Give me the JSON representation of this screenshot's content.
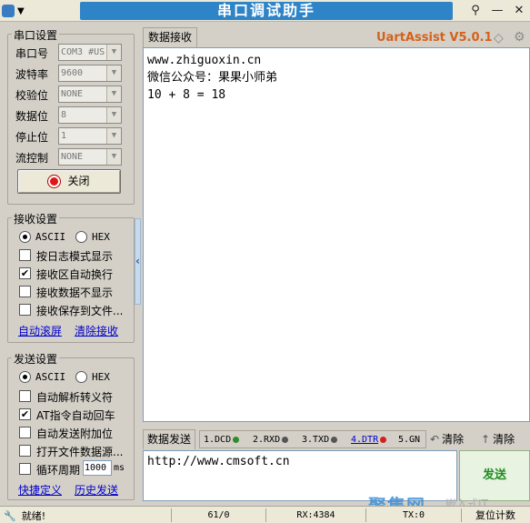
{
  "window": {
    "title": "串口调试助手",
    "brand": "UartAssist V5.0.1"
  },
  "serial": {
    "group_title": "串口设置",
    "port_label": "串口号",
    "port_value": "COM3 #US",
    "baud_label": "波特率",
    "baud_value": "9600",
    "parity_label": "校验位",
    "parity_value": "NONE",
    "databits_label": "数据位",
    "databits_value": "8",
    "stopbits_label": "停止位",
    "stopbits_value": "1",
    "flow_label": "流控制",
    "flow_value": "NONE",
    "close_label": "关闭"
  },
  "receive_settings": {
    "group_title": "接收设置",
    "ascii_label": "ASCII",
    "hex_label": "HEX",
    "options": [
      {
        "label": "按日志模式显示",
        "checked": false
      },
      {
        "label": "接收区自动换行",
        "checked": true
      },
      {
        "label": "接收数据不显示",
        "checked": false
      },
      {
        "label": "接收保存到文件...",
        "checked": false
      }
    ],
    "link_autoscroll": "自动滚屏",
    "link_clear": "清除接收"
  },
  "send_settings": {
    "group_title": "发送设置",
    "ascii_label": "ASCII",
    "hex_label": "HEX",
    "options": [
      {
        "label": "自动解析转义符",
        "checked": false
      },
      {
        "label": "AT指令自动回车",
        "checked": true
      },
      {
        "label": "自动发送附加位",
        "checked": false
      },
      {
        "label": "打开文件数据源...",
        "checked": false
      },
      {
        "label": "循环周期",
        "checked": false
      }
    ],
    "period_value": "1000",
    "period_unit": "ms",
    "link_shortcut": "快捷定义",
    "link_history": "历史发送"
  },
  "receive": {
    "tab_label": "数据接收",
    "lines": [
      "www.zhiguoxin.cn",
      "微信公众号：果果小师弟",
      "10 + 8 = 18"
    ]
  },
  "send": {
    "tab_label": "数据发送",
    "signals": [
      {
        "label": "1.DCD",
        "color": "#2e8b2e",
        "underline": false
      },
      {
        "label": "2.RXD",
        "color": "#555555",
        "underline": false
      },
      {
        "label": "3.TXD",
        "color": "#555555",
        "underline": false
      },
      {
        "label": "4.DTR",
        "color": "#d42020",
        "underline": true
      },
      {
        "label": "5.GN",
        "color": "#555555",
        "underline": false
      }
    ],
    "clear_label": "清除",
    "clear2_label": "清除",
    "text": "http://www.cmsoft.cn",
    "send_label": "发送"
  },
  "status": {
    "ready": "就绪!",
    "ratio": "61/0",
    "rx": "RX:4384",
    "tx": "TX:0",
    "reset": "复位计数"
  },
  "watermark": "聚集网",
  "watermark_sub": "嵌入式IT"
}
